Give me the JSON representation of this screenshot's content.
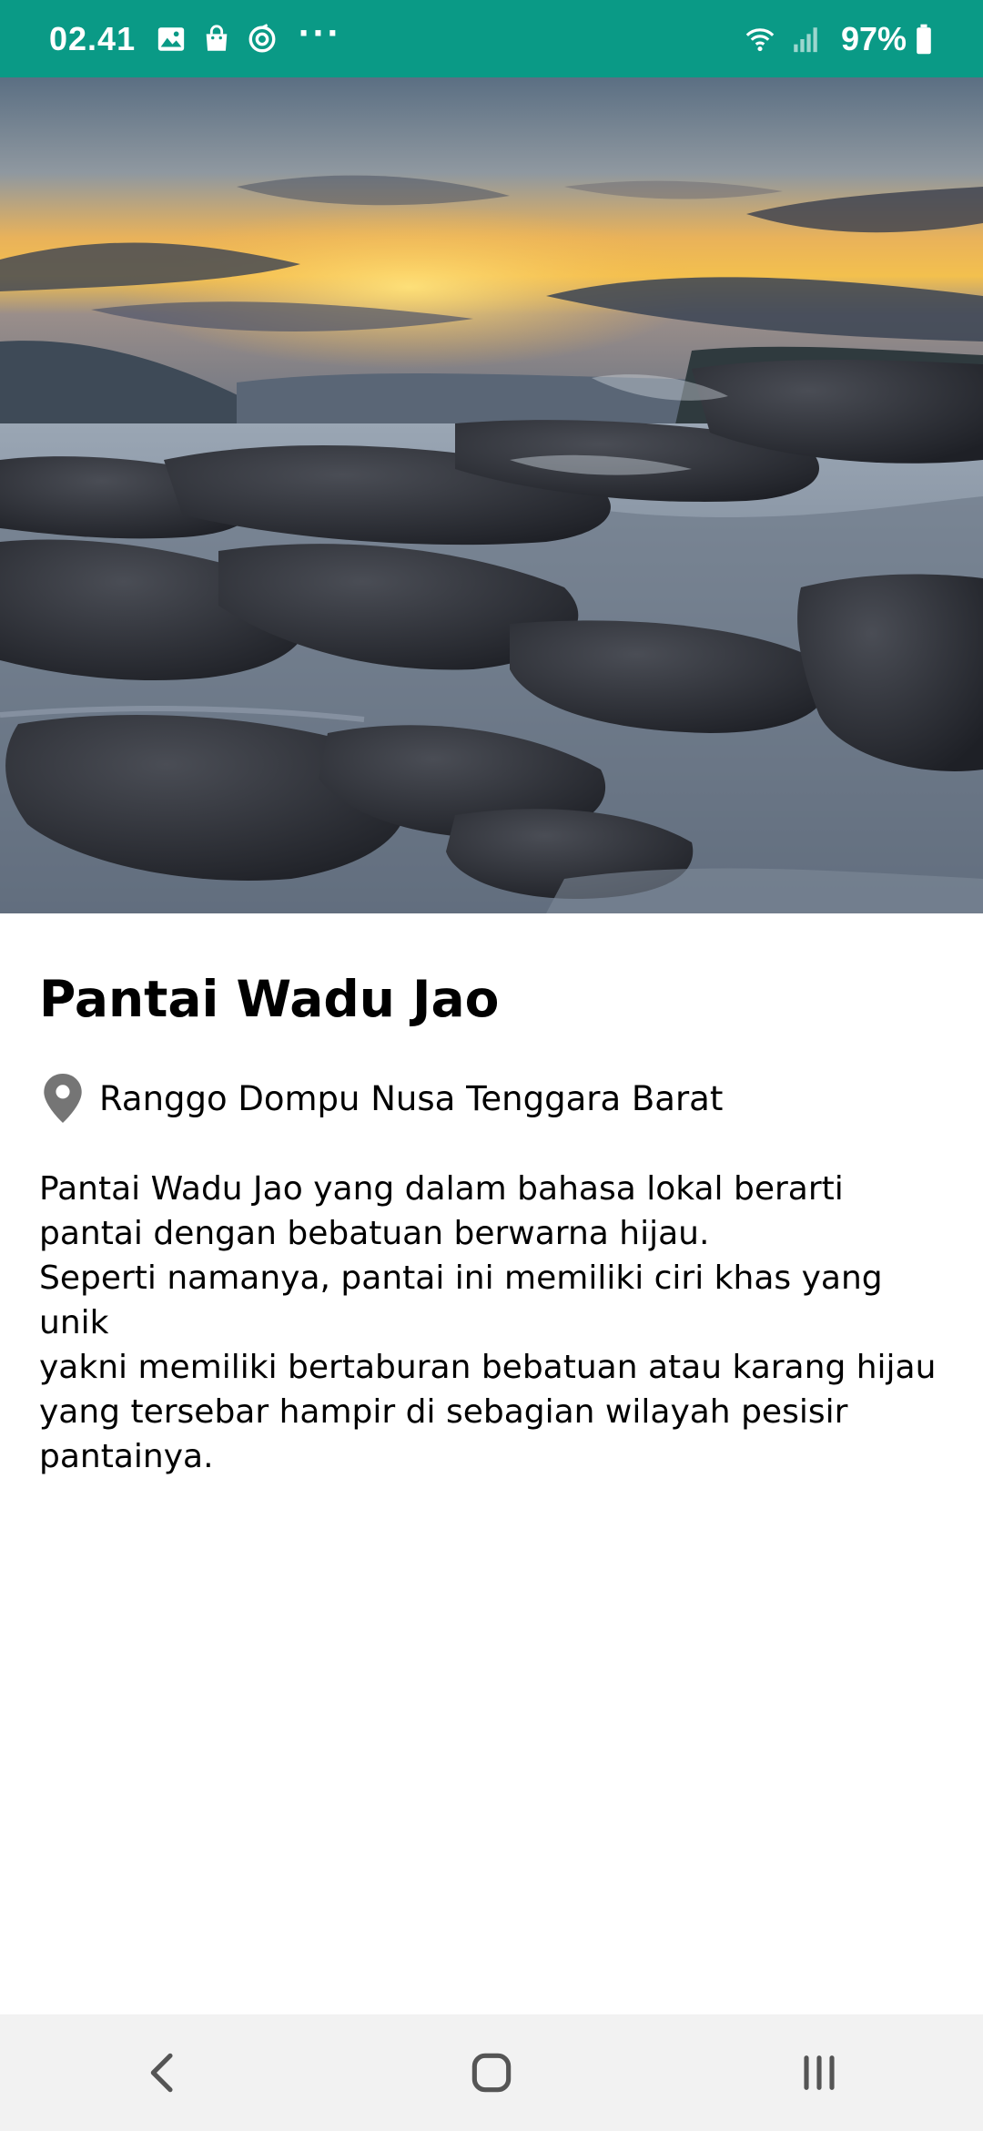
{
  "status_bar": {
    "time": "02.41",
    "battery_percent": "97%",
    "more_indicator": "···",
    "icons": [
      "image-icon",
      "shopping-bag-icon",
      "sync-icon",
      "wifi-icon",
      "signal-icon",
      "battery-icon"
    ],
    "background_color": "#0a9a86"
  },
  "hero": {
    "image_icon": "beach-photo"
  },
  "detail": {
    "title": "Pantai Wadu Jao",
    "location": "Ranggo Dompu Nusa Tenggara Barat",
    "description": "Pantai Wadu Jao yang dalam bahasa lokal berarti pantai dengan bebatuan berwarna hijau.\n Seperti namanya, pantai ini memiliki ciri khas yang unik\nyakni memiliki bertaburan bebatuan atau karang hijau\nyang tersebar hampir di sebagian wilayah pesisir pantainya."
  },
  "nav_bar": {
    "buttons": [
      "back-icon",
      "home-icon",
      "recents-icon"
    ]
  }
}
